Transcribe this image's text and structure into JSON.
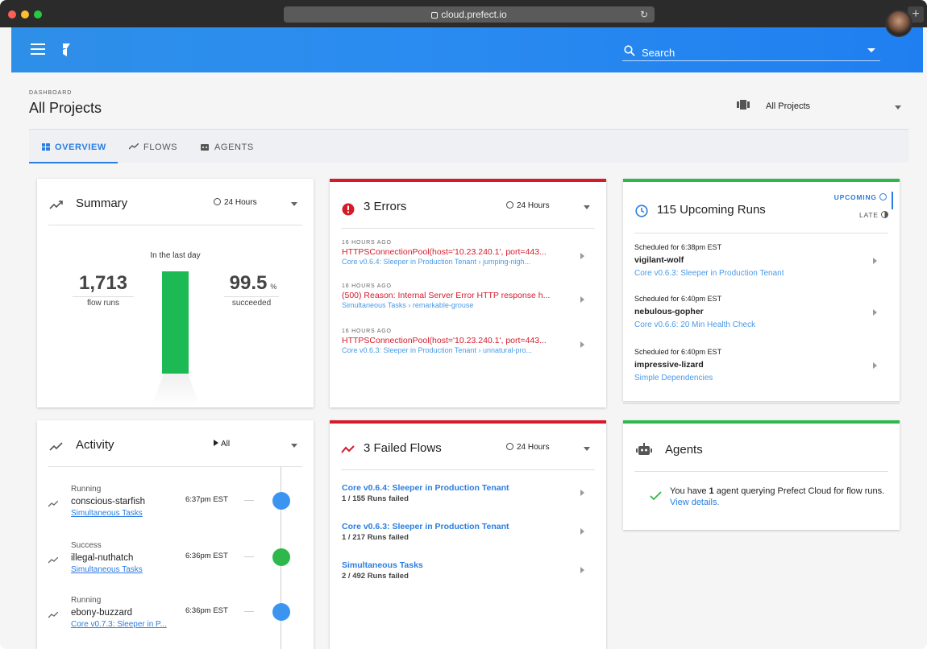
{
  "browser": {
    "url": "cloud.prefect.io"
  },
  "header": {
    "search_placeholder": "Search"
  },
  "page": {
    "breadcrumb": "DASHBOARD",
    "title": "All Projects",
    "project_select": "All Projects"
  },
  "tabs": [
    {
      "label": "OVERVIEW",
      "active": true
    },
    {
      "label": "FLOWS"
    },
    {
      "label": "AGENTS"
    }
  ],
  "summary": {
    "title": "Summary",
    "range": "24 Hours",
    "period": "In the last day",
    "flow_runs": "1,713",
    "flow_runs_label": "flow runs",
    "success_pct": "99.5",
    "pct_unit": "%",
    "succeeded_label": "succeeded",
    "bar_fraction": 0.995
  },
  "errors": {
    "title": "3 Errors",
    "range": "24 Hours",
    "items": [
      {
        "time": "16 HOURS AGO",
        "message": "HTTPSConnectionPool(host='10.23.240.1', port=443...",
        "flow": "Core v0.6.4: Sleeper in Production Tenant",
        "run": "jumping-nigh..."
      },
      {
        "time": "16 HOURS AGO",
        "message": "(500) Reason: Internal Server Error HTTP response h...",
        "flow": "Simultaneous Tasks",
        "run": "remarkable-grouse"
      },
      {
        "time": "16 HOURS AGO",
        "message": "HTTPSConnectionPool(host='10.23.240.1', port=443...",
        "flow": "Core v0.6.3: Sleeper in Production Tenant",
        "run": "unnatural-pro..."
      }
    ]
  },
  "upcoming": {
    "title": "115 Upcoming Runs",
    "tab_upcoming": "UPCOMING",
    "tab_late": "LATE",
    "items": [
      {
        "scheduled": "Scheduled for 6:38pm EST",
        "name": "vigilant-wolf",
        "flow": "Core v0.6.3: Sleeper in Production Tenant"
      },
      {
        "scheduled": "Scheduled for 6:40pm EST",
        "name": "nebulous-gopher",
        "flow": "Core v0.6.6: 20 Min Health Check"
      },
      {
        "scheduled": "Scheduled for 6:40pm EST",
        "name": "impressive-lizard",
        "flow": "Simple Dependencies"
      }
    ]
  },
  "activity": {
    "title": "Activity",
    "filter": "All",
    "items": [
      {
        "state": "Running",
        "name": "conscious-starfish",
        "flow": "Simultaneous Tasks",
        "time": "6:37pm EST",
        "color": "#3b95f0"
      },
      {
        "state": "Success",
        "name": "illegal-nuthatch",
        "flow": "Simultaneous Tasks",
        "time": "6:36pm EST",
        "color": "#2db84b"
      },
      {
        "state": "Running",
        "name": "ebony-buzzard",
        "flow": "Core v0.7.3: Sleeper in P...",
        "time": "6:36pm EST",
        "color": "#3b95f0"
      }
    ]
  },
  "failed": {
    "title": "3 Failed Flows",
    "range": "24 Hours",
    "items": [
      {
        "flow": "Core v0.6.4: Sleeper in Production Tenant",
        "runs": "1 / 155 Runs failed"
      },
      {
        "flow": "Core v0.6.3: Sleeper in Production Tenant",
        "runs": "1 / 217 Runs failed"
      },
      {
        "flow": "Simultaneous Tasks",
        "runs": "2 / 492 Runs failed"
      }
    ]
  },
  "agents": {
    "title": "Agents",
    "text_before": "You have ",
    "count": "1",
    "text_after": " agent querying Prefect Cloud for flow runs.",
    "link": "View details."
  }
}
